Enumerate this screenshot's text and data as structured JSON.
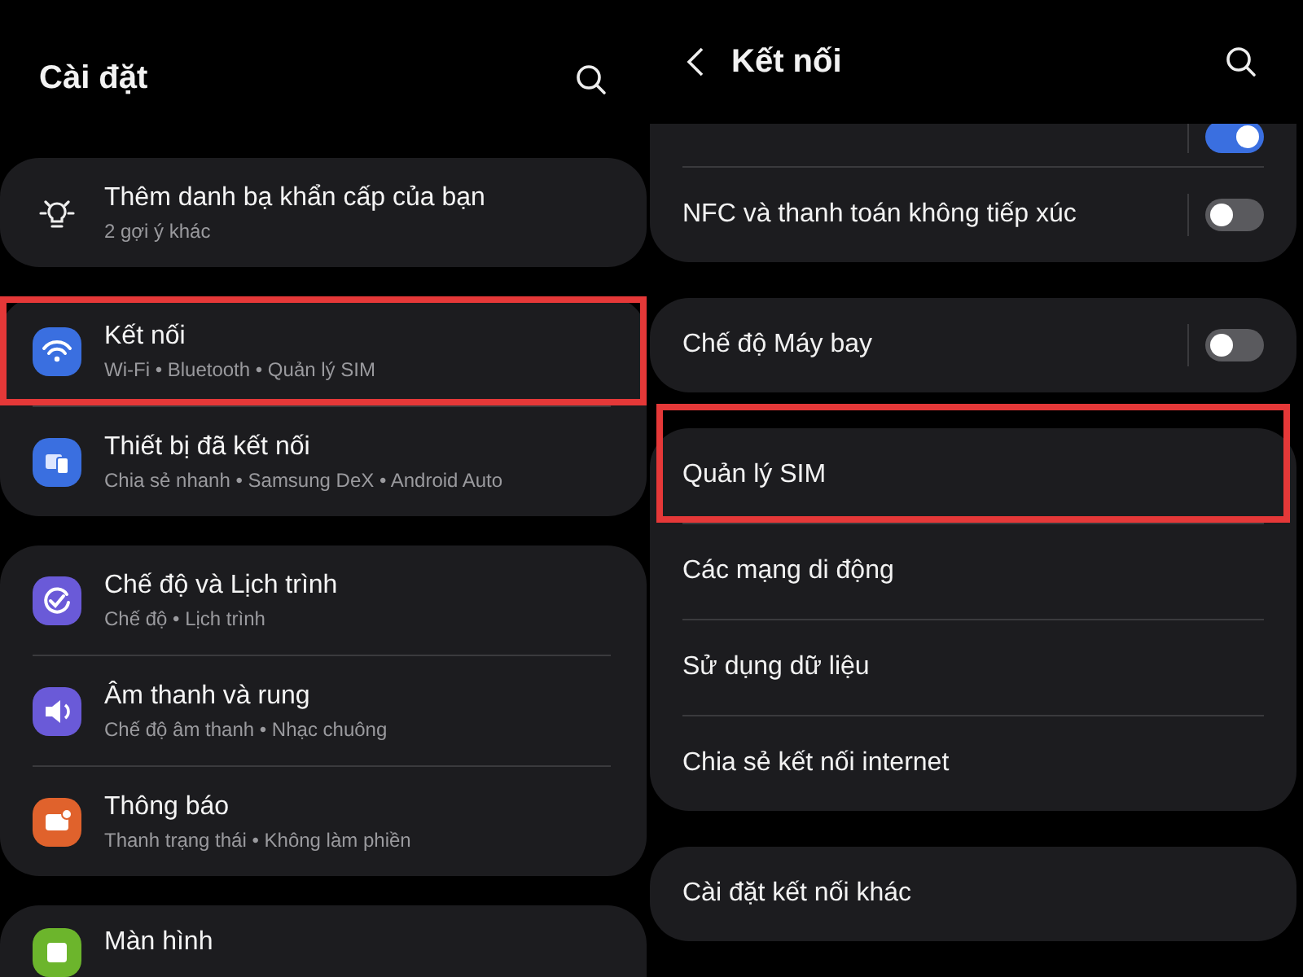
{
  "settings_screen": {
    "title": "Cài đặt",
    "groups": [
      {
        "items": [
          {
            "kind": "bulb",
            "title": "Thêm danh bạ khẩn cấp của bạn",
            "subtitle": "2 gợi ý khác",
            "highlighted": false
          }
        ]
      },
      {
        "items": [
          {
            "kind": "wifi",
            "color": "#3a6fe0",
            "title": "Kết nối",
            "subtitle": "Wi-Fi • Bluetooth • Quản lý SIM",
            "highlighted": true
          },
          {
            "kind": "devices",
            "color": "#3a6fe0",
            "title": "Thiết bị đã kết nối",
            "subtitle": "Chia sẻ nhanh • Samsung DeX • Android Auto",
            "highlighted": false
          }
        ]
      },
      {
        "items": [
          {
            "kind": "check",
            "color": "#6a5ad8",
            "title": "Chế độ và Lịch trình",
            "subtitle": "Chế độ • Lịch trình",
            "highlighted": false
          },
          {
            "kind": "speaker",
            "color": "#6a5ad8",
            "title": "Âm thanh và rung",
            "subtitle": "Chế độ âm thanh • Nhạc chuông",
            "highlighted": false
          },
          {
            "kind": "notification",
            "color": "#e0622c",
            "title": "Thông báo",
            "subtitle": "Thanh trạng thái • Không làm phiền",
            "highlighted": false
          }
        ]
      },
      {
        "items": [
          {
            "kind": "display",
            "color": "#6cb52c",
            "title": "Màn hình",
            "highlighted": false
          }
        ]
      }
    ]
  },
  "connections_screen": {
    "title": "Kết nối",
    "groups": [
      {
        "items": [
          {
            "kind": "toggle",
            "on": true
          },
          {
            "kind": "toggle",
            "label": "NFC và thanh toán không tiếp xúc",
            "on": false
          }
        ]
      },
      {
        "items": [
          {
            "kind": "toggle",
            "label": "Chế độ Máy bay",
            "on": false
          }
        ]
      },
      {
        "items": [
          {
            "kind": "link",
            "label": "Quản lý SIM",
            "highlighted": true
          },
          {
            "kind": "link",
            "label": "Các mạng di động",
            "highlighted": false
          },
          {
            "kind": "link",
            "label": "Sử dụng dữ liệu",
            "highlighted": false
          },
          {
            "kind": "link",
            "label": "Chia sẻ kết nối internet",
            "highlighted": false
          }
        ]
      },
      {
        "items": [
          {
            "kind": "link",
            "label": "Cài đặt kết nối khác",
            "highlighted": false
          }
        ]
      },
      {
        "kind": "blank"
      }
    ]
  }
}
